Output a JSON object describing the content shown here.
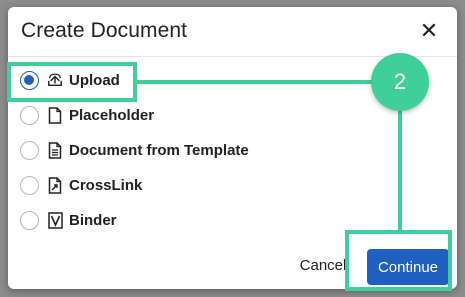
{
  "dialog": {
    "title": "Create Document",
    "close_glyph": "✕"
  },
  "options": [
    {
      "label": "Upload",
      "icon": "upload-icon",
      "selected": true
    },
    {
      "label": "Placeholder",
      "icon": "file-icon",
      "selected": false
    },
    {
      "label": "Document from Template",
      "icon": "document-icon",
      "selected": false
    },
    {
      "label": "CrossLink",
      "icon": "crosslink-icon",
      "selected": false
    },
    {
      "label": "Binder",
      "icon": "binder-icon",
      "selected": false
    }
  ],
  "footer": {
    "cancel_label": "Cancel",
    "continue_label": "Continue"
  },
  "annotation": {
    "step_number": "2",
    "color": "#3ecf9a"
  },
  "colors": {
    "accent": "#1f5fbf"
  }
}
